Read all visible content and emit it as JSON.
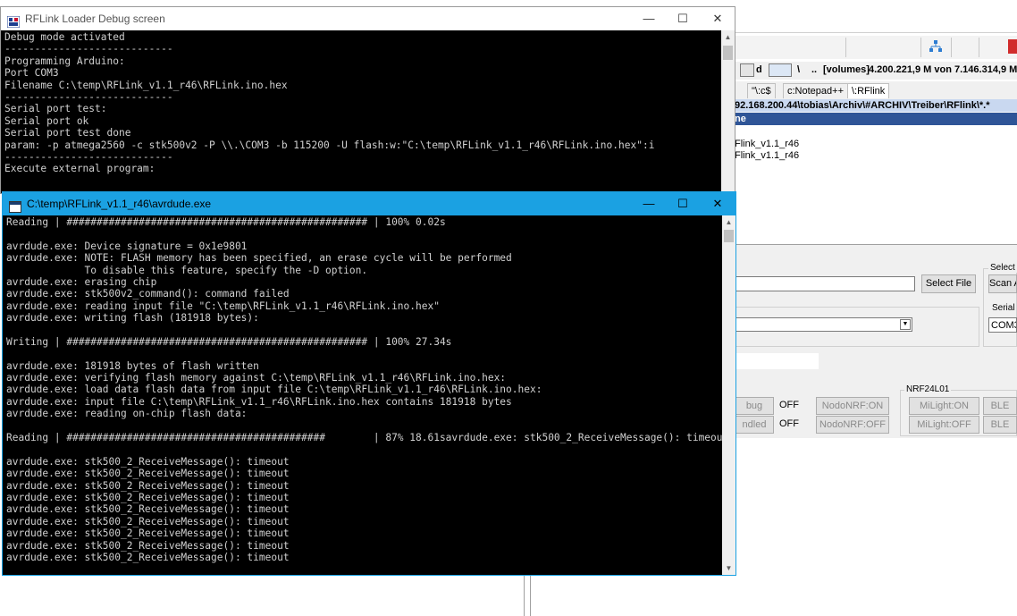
{
  "background_app": {
    "volumes_text": "[volumes]",
    "free_space_text": "4.200.221,9 M von 7.146.314,9 M",
    "drive_label": "d",
    "path_sep": "\\",
    "path_dots": "..",
    "tabs": [
      "\"\\:c$",
      "c:Notepad++",
      "\\:RFlink"
    ],
    "path_line": "92.168.200.44\\tobias\\Archiv\\#ARCHIV\\Treiber\\RFlink\\*.*",
    "column_header": "ne",
    "files": [
      "Flink_v1.1_r46",
      "Flink_v1.1_r46"
    ],
    "select_file_button": "Select File",
    "select_label": "Select S",
    "scan_button": "Scan A",
    "serial_label": "Serial P",
    "serial_value": "COM3",
    "debug_button": "bug",
    "debug_state": "OFF",
    "handled_button": "ndled",
    "handled_state": "OFF",
    "nodo_on_button": "NodoNRF:ON",
    "nodo_off_button": "NodoNRF:OFF",
    "nrf_group_label": "NRF24L01",
    "milight_on_button": "MiLight:ON",
    "milight_off_button": "MiLight:OFF",
    "ble_button_1": "BLE",
    "ble_button_2": "BLE"
  },
  "debug_window": {
    "title": "RFLink Loader Debug screen",
    "minimize": "—",
    "maximize": "☐",
    "close": "✕",
    "lines": [
      "Debug mode activated",
      "----------------------------",
      "Programming Arduino:",
      "Port COM3",
      "Filename C:\\temp\\RFLink_v1.1_r46\\RFLink.ino.hex",
      "----------------------------",
      "Serial port test:",
      "Serial port ok",
      "Serial port test done",
      "param: -p atmega2560 -c stk500v2 -P \\\\.\\COM3 -b 115200 -U flash:w:\"C:\\temp\\RFLink_v1.1_r46\\RFLink.ino.hex\":i",
      "----------------------------",
      "Execute external program:"
    ]
  },
  "avrdude_window": {
    "title": "C:\\temp\\RFLink_v1.1_r46\\avrdude.exe",
    "minimize": "—",
    "maximize": "☐",
    "close": "✕",
    "lines": [
      "Reading | ################################################## | 100% 0.02s",
      "",
      "avrdude.exe: Device signature = 0x1e9801",
      "avrdude.exe: NOTE: FLASH memory has been specified, an erase cycle will be performed",
      "             To disable this feature, specify the -D option.",
      "avrdude.exe: erasing chip",
      "avrdude.exe: stk500v2_command(): command failed",
      "avrdude.exe: reading input file \"C:\\temp\\RFLink_v1.1_r46\\RFLink.ino.hex\"",
      "avrdude.exe: writing flash (181918 bytes):",
      "",
      "Writing | ################################################## | 100% 27.34s",
      "",
      "avrdude.exe: 181918 bytes of flash written",
      "avrdude.exe: verifying flash memory against C:\\temp\\RFLink_v1.1_r46\\RFLink.ino.hex:",
      "avrdude.exe: load data flash data from input file C:\\temp\\RFLink_v1.1_r46\\RFLink.ino.hex:",
      "avrdude.exe: input file C:\\temp\\RFLink_v1.1_r46\\RFLink.ino.hex contains 181918 bytes",
      "avrdude.exe: reading on-chip flash data:",
      "",
      "Reading | ###########################################        | 87% 18.61savrdude.exe: stk500_2_ReceiveMessage(): timeout",
      "",
      "avrdude.exe: stk500_2_ReceiveMessage(): timeout",
      "avrdude.exe: stk500_2_ReceiveMessage(): timeout",
      "avrdude.exe: stk500_2_ReceiveMessage(): timeout",
      "avrdude.exe: stk500_2_ReceiveMessage(): timeout",
      "avrdude.exe: stk500_2_ReceiveMessage(): timeout",
      "avrdude.exe: stk500_2_ReceiveMessage(): timeout",
      "avrdude.exe: stk500_2_ReceiveMessage(): timeout",
      "avrdude.exe: stk500_2_ReceiveMessage(): timeout",
      "avrdude.exe: stk500_2_ReceiveMessage(): timeout"
    ]
  },
  "colors": {
    "avrdude_titlebar": "#1ba1e2",
    "debug_titlebar": "#ffffff",
    "console_bg": "#000000",
    "console_text": "#d0d0d0"
  }
}
